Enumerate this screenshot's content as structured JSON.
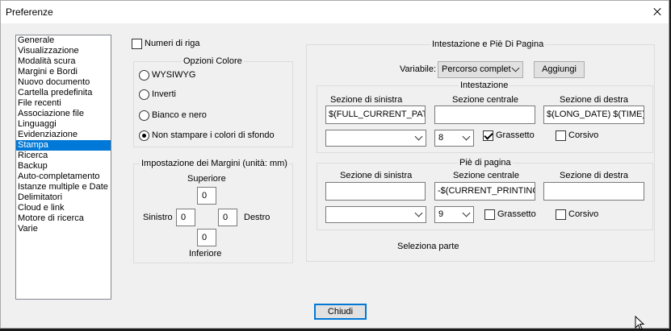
{
  "window": {
    "title": "Preferenze"
  },
  "sidebar": {
    "items": [
      "Generale",
      "Visualizzazione",
      "Modalità scura",
      "Margini e Bordi",
      "Nuovo documento",
      "Cartella predefinita",
      "File recenti",
      "Associazione file",
      "Linguaggi",
      "Evidenziazione",
      "Stampa",
      "Ricerca",
      "Backup",
      "Auto-completamento",
      "Istanze multiple e Date",
      "Delimitatori",
      "Cloud e link",
      "Motore di ricerca",
      "Varie"
    ],
    "selected": "Stampa"
  },
  "line_numbers": {
    "label": "Numeri di riga",
    "checked": false
  },
  "color_options": {
    "title": "Opzioni Colore",
    "options": [
      "WYSIWYG",
      "Inverti",
      "Bianco e nero",
      "Non stampare i colori di sfondo"
    ],
    "selected": "Non stampare i colori di sfondo"
  },
  "margins": {
    "title": "Impostazione dei Margini (unità: mm)",
    "top_label": "Superiore",
    "top": "0",
    "left_label": "Sinistro",
    "left": "0",
    "right_label": "Destro",
    "right": "0",
    "bottom_label": "Inferiore",
    "bottom": "0"
  },
  "header_footer": {
    "title": "Intestazione e Piè Di Pagina",
    "variable_label": "Variabile:",
    "variable_value": "Percorso complet",
    "add_label": "Aggiungi",
    "header": {
      "title": "Intestazione",
      "left_label": "Sezione di sinistra",
      "center_label": "Sezione centrale",
      "right_label": "Sezione di destra",
      "left_value": "$(FULL_CURRENT_PATH)",
      "center_value": "",
      "right_value": "$(LONG_DATE) $(TIME)",
      "font_value": "",
      "size_value": "8",
      "bold_label": "Grassetto",
      "bold": true,
      "italic_label": "Corsivo",
      "italic": false
    },
    "footer": {
      "title": "Piè di pagina",
      "left_label": "Sezione di sinistra",
      "center_label": "Sezione centrale",
      "right_label": "Sezione di destra",
      "left_value": "",
      "center_value": "-$(CURRENT_PRINTING_PAGE)-",
      "right_value": "",
      "font_value": "",
      "size_value": "9",
      "bold_label": "Grassetto",
      "bold": false,
      "italic_label": "Corsivo",
      "italic": false
    },
    "select_part": "Seleziona parte"
  },
  "close_label": "Chiudi"
}
